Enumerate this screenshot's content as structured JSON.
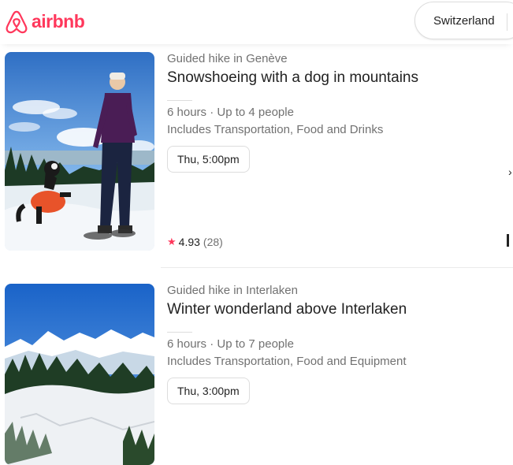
{
  "brand": {
    "name": "airbnb",
    "color": "#FF385C"
  },
  "search": {
    "location": "Switzerland"
  },
  "listings": [
    {
      "category": "Guided hike in Genève",
      "title": "Snowshoeing with a dog in mountains",
      "duration": "6 hours · Up to 4 people",
      "includes": "Includes Transportation, Food and Drinks",
      "time_slot": "Thu, 5:00pm",
      "rating": {
        "score": "4.93",
        "count": "(28)"
      }
    },
    {
      "category": "Guided hike in Interlaken",
      "title": "Winter wonderland above Interlaken",
      "duration": "6 hours · Up to 7 people",
      "includes": "Includes Transportation, Food and Equipment",
      "time_slot": "Thu, 3:00pm"
    }
  ],
  "icons": {
    "logo": "airbnb-belo-icon",
    "star": "star-icon",
    "next": "chevron-right-icon"
  }
}
